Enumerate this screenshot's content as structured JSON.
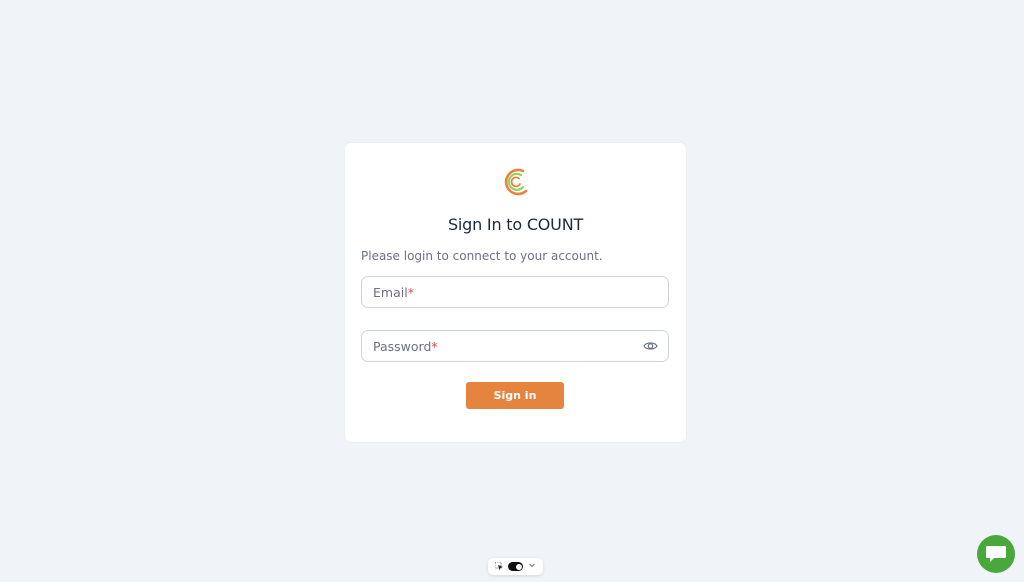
{
  "login": {
    "title": "Sign In to COUNT",
    "subtitle": "Please login to connect to your account.",
    "email_label": "Email",
    "password_label": "Password",
    "required_mark": "*",
    "sign_in_label": "Sign in"
  },
  "colors": {
    "accent": "#e5843f",
    "background": "#f0f3f8",
    "chat": "#49a83b",
    "required": "#e0474c"
  },
  "icons": {
    "logo": "count-logo-icon",
    "password_toggle": "eye-icon",
    "theme_cursor": "cursor-icon",
    "theme_switch": "toggle-switch-icon",
    "theme_dropdown": "chevron-down-icon",
    "chat": "chat-bubble-icon"
  }
}
